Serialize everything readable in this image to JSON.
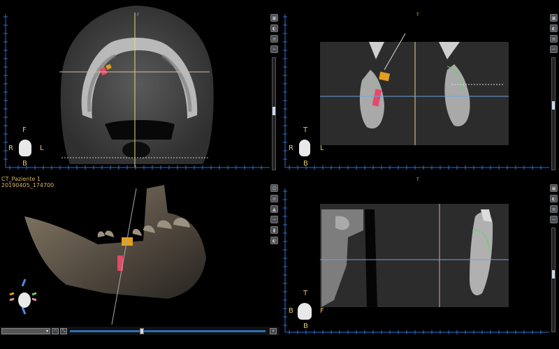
{
  "panes": {
    "axial": {
      "orient": {
        "top": "F",
        "left": "R",
        "right": "L",
        "bottom": "B"
      },
      "top_marker": "F"
    },
    "coronal": {
      "orient": {
        "top": "T",
        "left": "R",
        "right": "L",
        "bottom": "B"
      },
      "top_marker": "T"
    },
    "three_d": {
      "case_name": "CT_Paziente 1",
      "case_id": "20190405_174700"
    },
    "sagittal": {
      "orient": {
        "top": "T",
        "left": "B",
        "right": "F",
        "bottom": "B"
      },
      "top_marker": "T"
    }
  },
  "toolbar_icons": [
    "view-3d-icon",
    "grayscale-icon",
    "layers-icon",
    "nerve-icon",
    "teeth-icon",
    "implant-icon"
  ],
  "bottom_bar": {
    "combo_symbol": "▾"
  },
  "colors": {
    "ruler": "#2a6fd1",
    "crosshair_yellow": "#e6d98a",
    "crosshair_blue": "#6aa6e0",
    "crosshair_pink": "#e0a6a6",
    "implant": "#e24a6a",
    "abutment": "#e0a020"
  }
}
